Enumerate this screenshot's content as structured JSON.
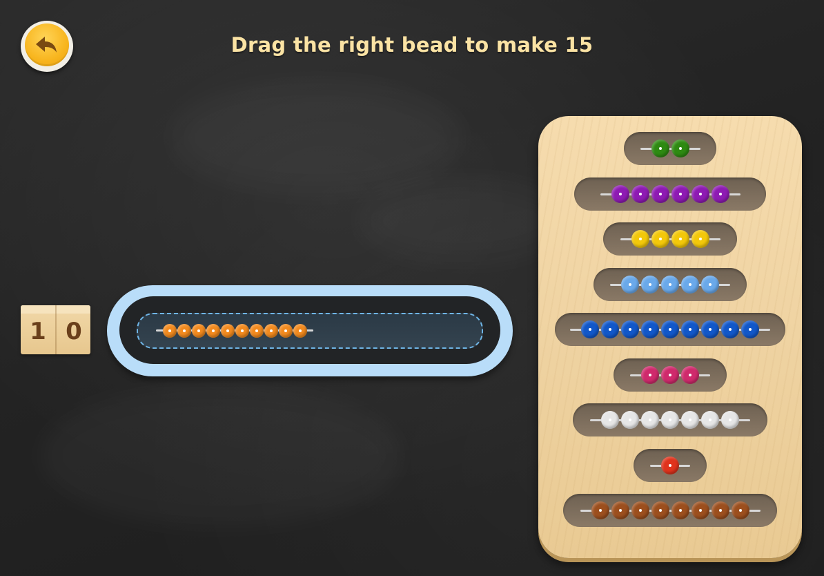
{
  "title": "Drag the right bead to make 15",
  "counter": {
    "tens": "1",
    "ones": "0"
  },
  "track": {
    "bead_count": 10,
    "bead_color": "#f28a1e"
  },
  "bead_rods": [
    {
      "name": "bead-rod-2",
      "count": 2,
      "color": "#2e8a12"
    },
    {
      "name": "bead-rod-6",
      "count": 6,
      "color": "#8e1bb3"
    },
    {
      "name": "bead-rod-4",
      "count": 4,
      "color": "#f3c80a"
    },
    {
      "name": "bead-rod-5",
      "count": 5,
      "color": "#6aa9ea"
    },
    {
      "name": "bead-rod-9",
      "count": 9,
      "color": "#1157c9"
    },
    {
      "name": "bead-rod-3",
      "count": 3,
      "color": "#cf2a6c"
    },
    {
      "name": "bead-rod-7",
      "count": 7,
      "color": "#e6e6e6"
    },
    {
      "name": "bead-rod-1",
      "count": 1,
      "color": "#e0331c"
    },
    {
      "name": "bead-rod-8",
      "count": 8,
      "color": "#9c4f1e"
    }
  ]
}
